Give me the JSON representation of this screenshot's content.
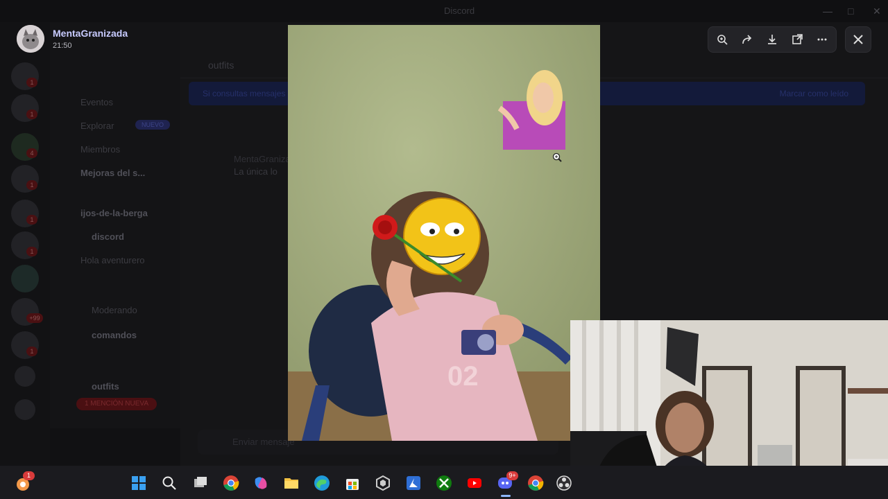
{
  "window": {
    "title": "Discord"
  },
  "rail": {
    "badges": [
      "1",
      "1",
      "4",
      "1",
      "1",
      "1",
      "+99",
      "+99",
      "1"
    ]
  },
  "channels": {
    "items": [
      {
        "label": "Eventos"
      },
      {
        "label": "Explorar"
      },
      {
        "label": "Miembros"
      },
      {
        "label": "Mejoras del s..."
      },
      {
        "label": "ijos-de-la-berga"
      },
      {
        "label": "discord"
      },
      {
        "label": "Hola aventurero"
      },
      {
        "label": "Moderando"
      },
      {
        "label": "comandos"
      },
      {
        "label": "outfits"
      }
    ],
    "new_tag": "NUEVO",
    "mentions_badge": "1 MENCIÓN NUEVA"
  },
  "chat": {
    "channel": "outfits",
    "notice_left": "Si consultas mensajes anteriores",
    "notice_right": "Marcar como leído",
    "author": "MentaGranizada",
    "message": "La única lo",
    "input_placeholder": "Enviar mensaje"
  },
  "viewer": {
    "username": "MentaGranizada",
    "time": "21:50",
    "toolbar": [
      "zoom-icon",
      "forward-icon",
      "download-icon",
      "open-external-icon",
      "more-icon"
    ],
    "close": "close-icon"
  },
  "taskbar": {
    "items": [
      "start-icon",
      "search-icon",
      "taskview-icon",
      "chrome-icon",
      "copilot-icon",
      "file-explorer-icon",
      "edge-icon",
      "store-icon",
      "app-icon",
      "azure-icon",
      "xbox-icon",
      "youtube-icon",
      "discord-icon",
      "chrome-profile-icon",
      "obs-icon"
    ],
    "discord_badge": "9+",
    "tray_badge": "1"
  },
  "colors": {
    "accent": "#5865f2",
    "username": "#c8cbff",
    "badge": "#d83b3b"
  }
}
